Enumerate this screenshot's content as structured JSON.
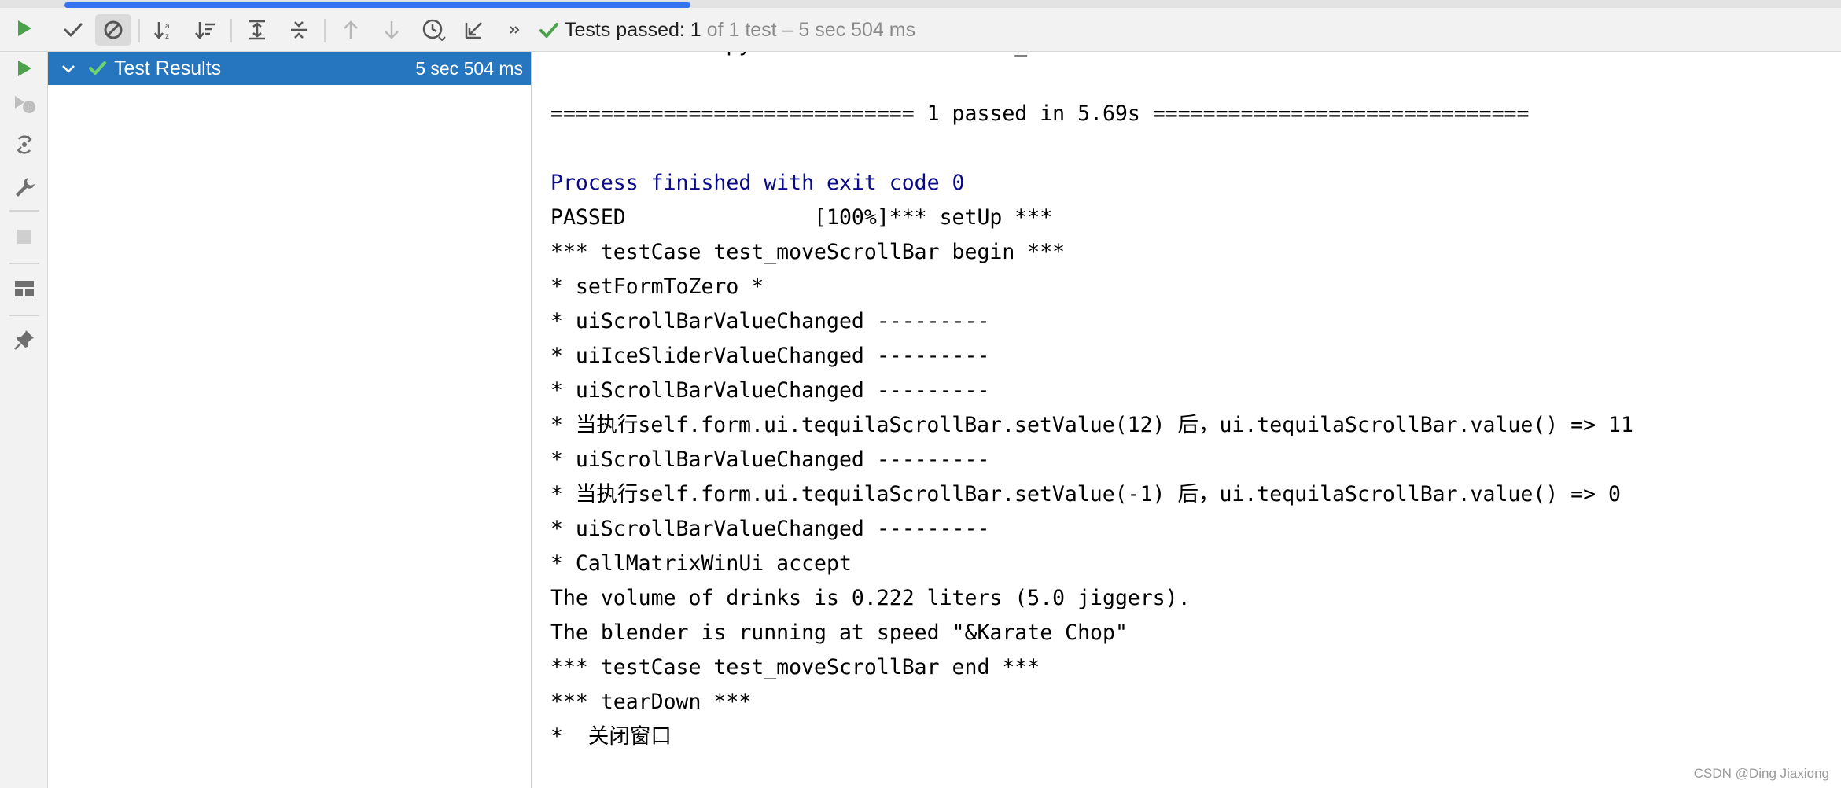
{
  "window": {
    "progress_fraction": 0.34
  },
  "toolbar": {
    "buttons": [
      {
        "name": "rerun-icon",
        "color": "#4aa34a"
      },
      {
        "name": "show-passed-icon"
      },
      {
        "name": "show-ignored-icon",
        "active": true
      },
      {
        "name": "sort-alphabetically-icon"
      },
      {
        "name": "sort-by-duration-icon"
      },
      {
        "name": "expand-all-icon"
      },
      {
        "name": "collapse-all-icon"
      },
      {
        "name": "previous-failed-icon"
      },
      {
        "name": "next-failed-icon"
      },
      {
        "name": "test-history-icon"
      },
      {
        "name": "import-tests-icon"
      },
      {
        "name": "more-icon"
      }
    ],
    "status": {
      "prefix": "Tests passed: 1",
      "suffix": "of 1 test – 5 sec 504 ms"
    },
    "status_color": "#4aa34a"
  },
  "left_strip": {
    "buttons": [
      "rerun-icon",
      "rerun-failed-icon",
      "toggle-auto-test-icon",
      "settings-wrench-icon",
      "stop-icon",
      "layout-icon",
      "pin-icon"
    ]
  },
  "tree": {
    "root": {
      "label": "Test Results",
      "time": "5 sec 504 ms",
      "status": "passed"
    }
  },
  "console": {
    "lines": [
      "matrixWinTest.py::matrixWinTest::test_moveScrollBar",
      "",
      "============================= 1 passed in 5.69s ==============================",
      "",
      "Process finished with exit code 0",
      "PASSED               [100%]*** setUp ***",
      "*** testCase test_moveScrollBar begin ***",
      "* setFormToZero *",
      "* uiScrollBarValueChanged ---------",
      "* uiIceSliderValueChanged ---------",
      "* uiScrollBarValueChanged ---------",
      "* 当执行self.form.ui.tequilaScrollBar.setValue(12) 后，ui.tequilaScrollBar.value() => 11",
      "* uiScrollBarValueChanged ---------",
      "* 当执行self.form.ui.tequilaScrollBar.setValue(-1) 后，ui.tequilaScrollBar.value() => 0",
      "* uiScrollBarValueChanged ---------",
      "* CallMatrixWinUi accept",
      "The volume of drinks is 0.222 liters (5.0 jiggers).",
      "The blender is running at speed \"&Karate Chop\"",
      "*** testCase test_moveScrollBar end ***",
      "*** tearDown ***",
      "*  关闭窗口"
    ],
    "process_line_color": "#0a0a8a"
  },
  "watermark": "CSDN @Ding Jiaxiong"
}
